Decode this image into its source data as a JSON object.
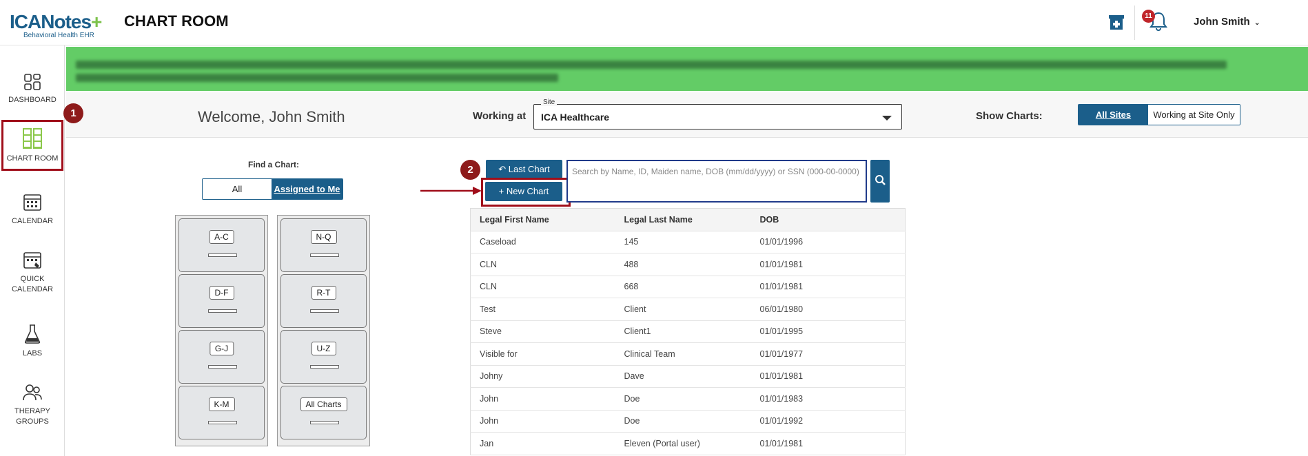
{
  "header": {
    "brand_text": "ICANotes",
    "brand_plus": "+",
    "brand_sub": "Behavioral Health EHR",
    "page_title": "CHART ROOM",
    "notification_count": "11",
    "user_name": "John Smith"
  },
  "sidebar": {
    "items": [
      {
        "label": "DASHBOARD"
      },
      {
        "label": "CHART ROOM"
      },
      {
        "label": "CALENDAR"
      },
      {
        "label": "QUICK CALENDAR"
      },
      {
        "label": "LABS"
      },
      {
        "label": "THERAPY GROUPS"
      }
    ]
  },
  "steps": [
    "1",
    "2"
  ],
  "welcome": {
    "text": "Welcome, John Smith",
    "working_at_label": "Working at",
    "site_legend": "Site",
    "site_value": "ICA Healthcare",
    "show_charts_label": "Show Charts:",
    "show_options": [
      "All Sites",
      "Working at Site Only"
    ]
  },
  "find_chart": {
    "title": "Find a Chart:",
    "filter_options": [
      "All",
      "Assigned to Me"
    ],
    "drawers_left": [
      "A-C",
      "D-F",
      "G-J",
      "K-M"
    ],
    "drawers_right": [
      "N-Q",
      "R-T",
      "U-Z",
      "All Charts"
    ]
  },
  "search": {
    "last_chart_label": "Last Chart",
    "new_chart_label": "New Chart",
    "placeholder": "Search by Name, ID, Maiden name, DOB (mm/dd/yyyy) or SSN (000-00-0000)"
  },
  "table": {
    "columns": [
      "Legal First Name",
      "Legal Last Name",
      "DOB"
    ],
    "rows": [
      [
        "Caseload",
        "145",
        "01/01/1996"
      ],
      [
        "CLN",
        "488",
        "01/01/1981"
      ],
      [
        "CLN",
        "668",
        "01/01/1981"
      ],
      [
        "Test",
        "Client",
        "06/01/1980"
      ],
      [
        "Steve",
        "Client1",
        "01/01/1995"
      ],
      [
        "Visible for",
        "Clinical Team",
        "01/01/1977"
      ],
      [
        "Johny",
        "Dave",
        "01/01/1981"
      ],
      [
        "John",
        "Doe",
        "01/01/1983"
      ],
      [
        "John",
        "Doe",
        "01/01/1992"
      ],
      [
        "Jan",
        "Eleven (Portal user)",
        "01/01/1981"
      ]
    ]
  },
  "colors": {
    "primary": "#1b5e8a",
    "accent_green": "#7cc24a",
    "banner_green": "#63cc66",
    "highlight_red": "#a00e1a"
  }
}
